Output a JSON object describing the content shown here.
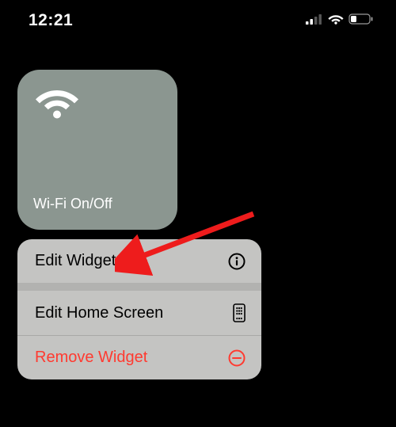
{
  "status": {
    "time": "12:21"
  },
  "widget": {
    "label": "Wi-Fi On/Off"
  },
  "menu": {
    "edit_widget": "Edit Widget",
    "edit_home_screen": "Edit Home Screen",
    "remove_widget": "Remove Widget"
  }
}
